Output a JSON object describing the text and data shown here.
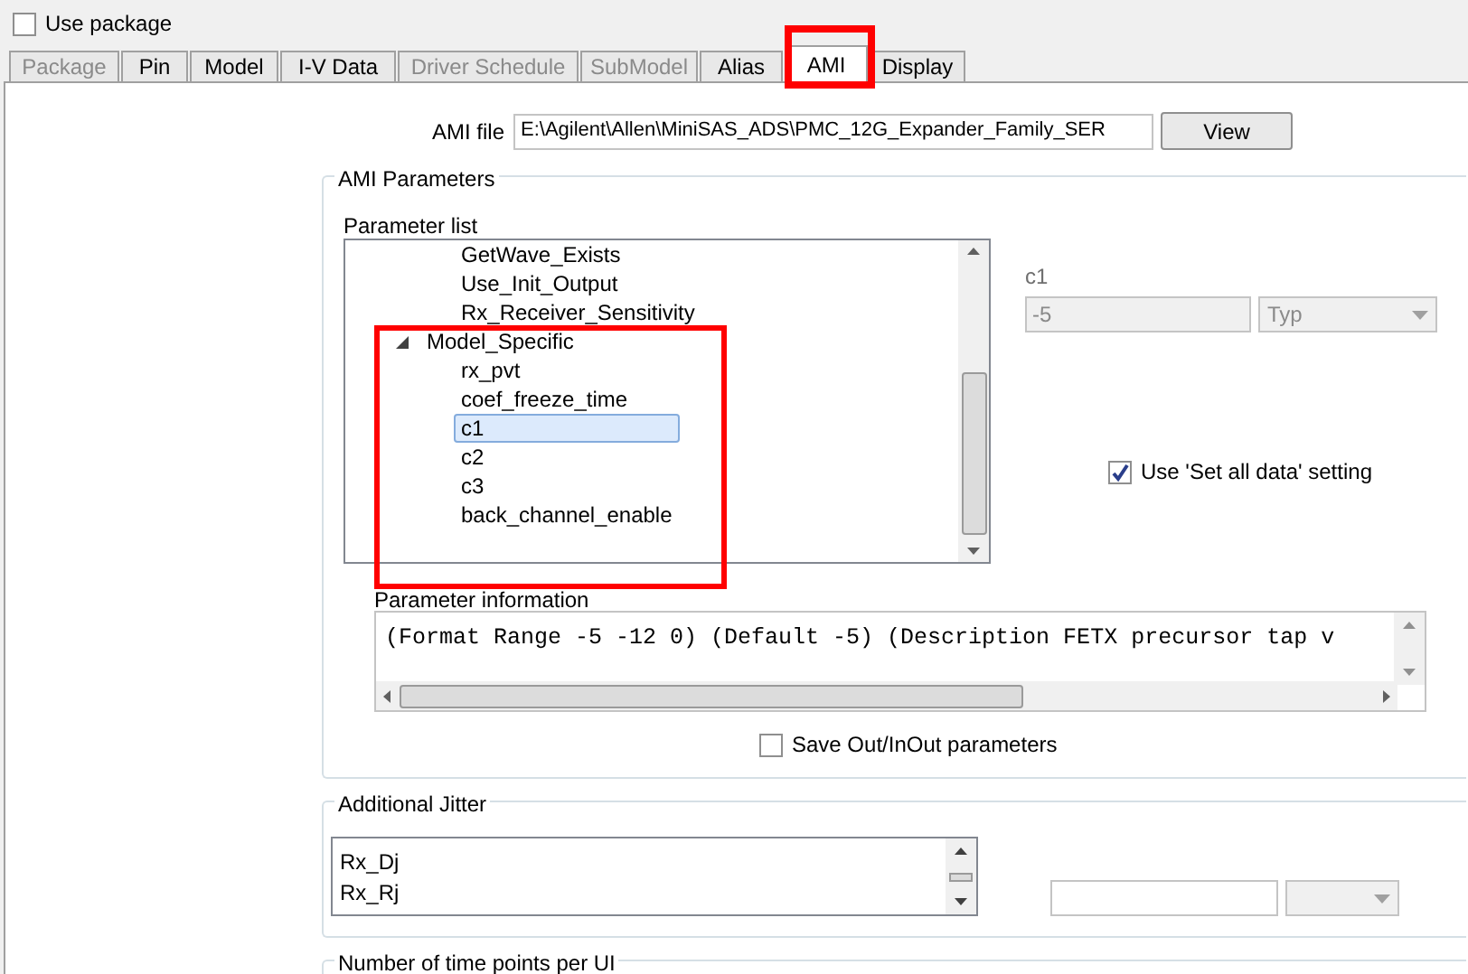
{
  "use_package": {
    "label": "Use package",
    "checked": false
  },
  "tabs": [
    {
      "label": "Package",
      "selected": false,
      "disabled": true
    },
    {
      "label": "Pin",
      "selected": false,
      "disabled": false
    },
    {
      "label": "Model",
      "selected": false,
      "disabled": false
    },
    {
      "label": "I-V Data",
      "selected": false,
      "disabled": false
    },
    {
      "label": "Driver Schedule",
      "selected": false,
      "disabled": true
    },
    {
      "label": "SubModel",
      "selected": false,
      "disabled": true
    },
    {
      "label": "Alias",
      "selected": false,
      "disabled": false
    },
    {
      "label": "AMI",
      "selected": true,
      "disabled": false
    },
    {
      "label": "Display",
      "selected": false,
      "disabled": false
    }
  ],
  "ami_file": {
    "label": "AMI file",
    "value": "E:\\Agilent\\Allen\\MiniSAS_ADS\\PMC_12G_Expander_Family_SER",
    "button": "View"
  },
  "ami_parameters": {
    "title": "AMI Parameters",
    "parameter_list": {
      "label": "Parameter list",
      "items": [
        {
          "label": "GetWave_Exists",
          "selected": false
        },
        {
          "label": "Use_Init_Output",
          "selected": false
        },
        {
          "label": "Rx_Receiver_Sensitivity",
          "selected": false
        },
        {
          "label": "Model_Specific",
          "selected": false,
          "expanded": true,
          "children": [
            {
              "label": "rx_pvt",
              "selected": false
            },
            {
              "label": "coef_freeze_time",
              "selected": false
            },
            {
              "label": "c1",
              "selected": true
            },
            {
              "label": "c2",
              "selected": false
            },
            {
              "label": "c3",
              "selected": false
            },
            {
              "label": "back_channel_enable",
              "selected": false
            }
          ]
        }
      ]
    },
    "selected_parameter": {
      "label": "c1",
      "value": "-5",
      "type": "Typ"
    },
    "set_all_data": {
      "label": "Use 'Set all data' setting",
      "checked": true
    },
    "parameter_information": {
      "label": "Parameter information",
      "text": "(Format Range -5 -12 0) (Default -5) (Description FETX precursor tap v"
    },
    "save_out_inout": {
      "label": "Save Out/InOut parameters",
      "checked": false
    }
  },
  "additional_jitter": {
    "title": "Additional Jitter",
    "items": [
      "Rx_Dj",
      "Rx_Rj"
    ]
  },
  "time_points": {
    "title": "Number of time points per UI"
  }
}
